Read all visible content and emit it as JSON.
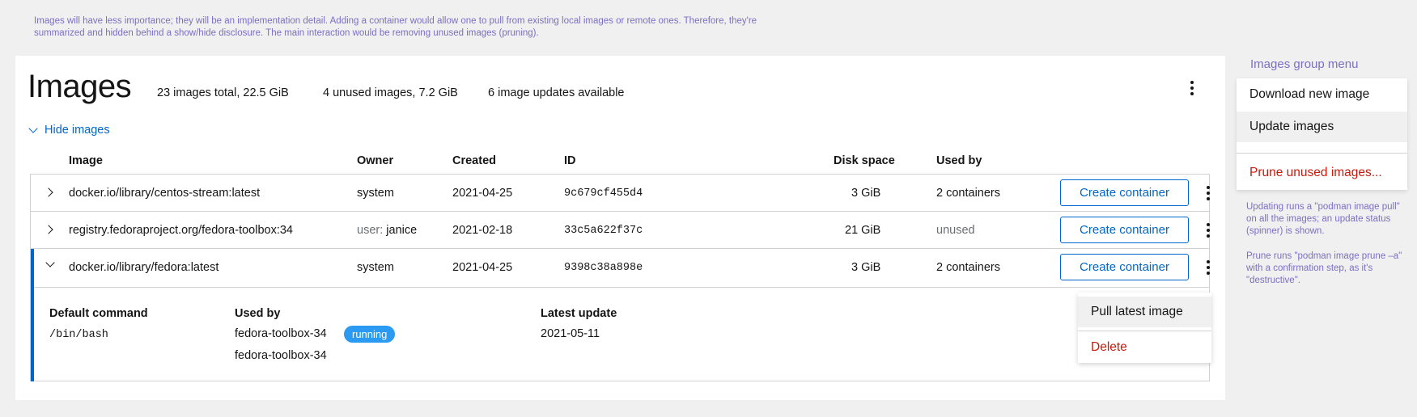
{
  "annotations": {
    "top_note": "Images will have less importance; they will be an implementation detail. Adding a container would allow one to pull from existing local images or remote ones. Therefore, they're summarized and hidden behind a show/hide disclosure. The main interaction would be removing unused images (pruning).",
    "side_menu_title": "Images group menu",
    "update_note": "Updating runs a \"podman image pull\" on all the images; an update status (spinner) is shown.",
    "prune_note": "Prune runs \"podman image prune –a\" with a confirmation step, as it's \"destructive\"."
  },
  "header": {
    "title": "Images",
    "stats": [
      "23 images total, 22.5 GiB",
      "4 unused images, 7.2 GiB",
      "6 image updates available"
    ],
    "kebab_icon": "kebab-menu-icon"
  },
  "toggle": {
    "label": "Hide images",
    "icon": "chevron-down-icon"
  },
  "table": {
    "columns": [
      "Image",
      "Owner",
      "Created",
      "ID",
      "Disk space",
      "Used by"
    ],
    "create_label": "Create container",
    "rows": [
      {
        "image": "docker.io/library/centos-stream:latest",
        "owner": "system",
        "owner_prefix": "",
        "created": "2021-04-25",
        "id": "9c679cf455d4",
        "disk": "3 GiB",
        "used_by": "2 containers",
        "expanded": false
      },
      {
        "image": "registry.fedoraproject.org/fedora-toolbox:34",
        "owner": "janice",
        "owner_prefix": "user:",
        "created": "2021-02-18",
        "id": "33c5a622f37c",
        "disk": "21 GiB",
        "used_by": "unused",
        "expanded": false
      },
      {
        "image": "docker.io/library/fedora:latest",
        "owner": "system",
        "owner_prefix": "",
        "created": "2021-04-25",
        "id": "9398c38a898e",
        "disk": "3 GiB",
        "used_by": "2 containers",
        "expanded": true
      }
    ]
  },
  "details": {
    "default_command_label": "Default command",
    "default_command": "/bin/bash",
    "used_by_label": "Used by",
    "used_by": [
      "fedora-toolbox-34",
      "fedora-toolbox-34"
    ],
    "running_badge": "running",
    "latest_update_label": "Latest update",
    "latest_update": "2021-05-11"
  },
  "row_menu": {
    "items": [
      "Pull latest image",
      "Delete"
    ]
  },
  "group_menu": {
    "items": [
      "Download new image",
      "Update images",
      "Prune unused images..."
    ]
  },
  "colors": {
    "accent": "#0066cc",
    "danger": "#c9190b",
    "annotation": "#7b6fc4",
    "badge": "#2b9af3"
  }
}
